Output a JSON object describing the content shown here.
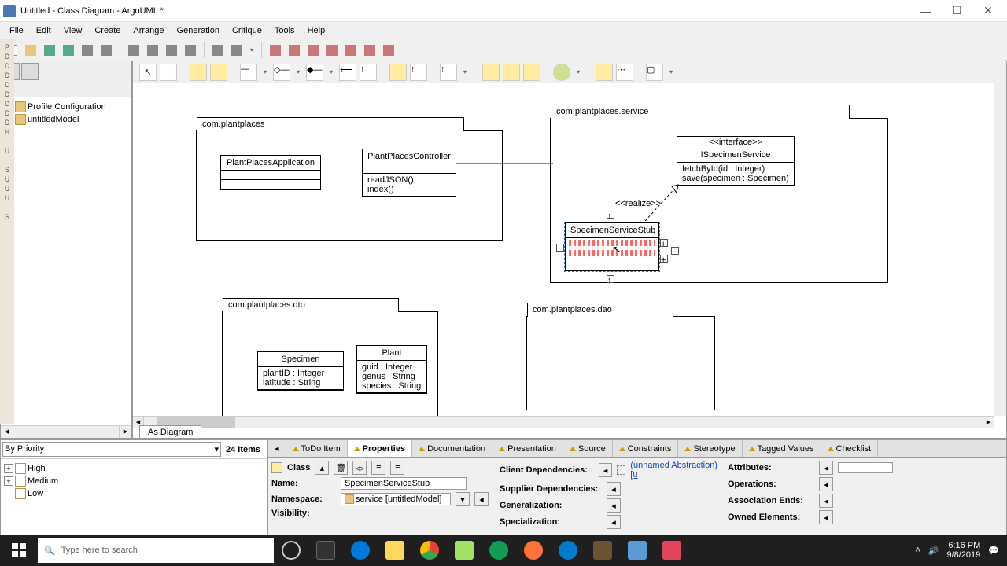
{
  "window": {
    "title": "Untitled - Class Diagram - ArgoUML *"
  },
  "menus": [
    "File",
    "Edit",
    "View",
    "Create",
    "Arrange",
    "Generation",
    "Critique",
    "Tools",
    "Help"
  ],
  "tree": {
    "items": [
      {
        "label": "Profile Configuration"
      },
      {
        "label": "untitledModel"
      }
    ]
  },
  "diagram": {
    "tab": "As Diagram",
    "packages": {
      "p1": {
        "name": "com.plantplaces"
      },
      "p2": {
        "name": "com.plantplaces.service"
      },
      "p3": {
        "name": "com.plantplaces.dto"
      },
      "p4": {
        "name": "com.plantplaces.dao"
      }
    },
    "classes": {
      "c1": {
        "name": "PlantPlacesApplication"
      },
      "c2": {
        "name": "PlantPlacesController",
        "ops": [
          "readJSON()",
          "index()"
        ]
      },
      "c3": {
        "stereo": "<<interface>>",
        "name": "ISpecimenService",
        "ops": [
          "fetchById(id : Integer)",
          "save(specimen : Specimen)"
        ]
      },
      "c4": {
        "name": "SpecimenServiceStub"
      },
      "c5": {
        "name": "Specimen",
        "attrs": [
          "plantID : Integer",
          "latitude : String"
        ]
      },
      "c6": {
        "name": "Plant",
        "attrs": [
          "guid : Integer",
          "genus : String",
          "species : String"
        ]
      }
    },
    "realize_label": "<<realize>>"
  },
  "todo": {
    "filter": "By Priority",
    "count": "24 Items",
    "levels": [
      "High",
      "Medium",
      "Low"
    ]
  },
  "prop_tabs": [
    "ToDo Item",
    "Properties",
    "Documentation",
    "Presentation",
    "Source",
    "Constraints",
    "Stereotype",
    "Tagged Values",
    "Checklist"
  ],
  "props": {
    "type_label": "Class",
    "name_label": "Name:",
    "name_value": "SpecimenServiceStub",
    "namespace_label": "Namespace:",
    "namespace_value": "service [untitledModel]",
    "visibility_label": "Visibility:",
    "client_dep_label": "Client Dependencies:",
    "client_dep_value": "(unnamed Abstraction) [u",
    "supplier_dep_label": "Supplier Dependencies:",
    "generalization_label": "Generalization:",
    "specialization_label": "Specialization:",
    "attributes_label": "Attributes:",
    "operations_label": "Operations:",
    "assoc_ends_label": "Association Ends:",
    "owned_label": "Owned Elements:"
  },
  "taskbar": {
    "search_placeholder": "Type here to search",
    "time": "6:16 PM",
    "date": "9/8/2019"
  }
}
